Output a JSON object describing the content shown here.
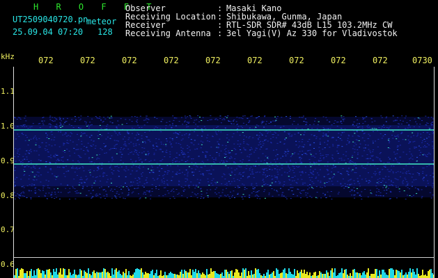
{
  "title_text": "H R O F F T",
  "file_name": "UT2509040720.pn",
  "file_suffix": "meteor",
  "datetime": "25.09.04 07:20",
  "count": "128",
  "fields": [
    {
      "label": "Observer",
      "sep": ":",
      "value": "Masaki Kano"
    },
    {
      "label": "Receiving Location",
      "sep": ":",
      "value": "Shibukawa, Gunma, Japan"
    },
    {
      "label": "Receiver",
      "sep": ":",
      "value": "RTL-SDR SDR# 43dB L15 103.2MHz CW"
    },
    {
      "label": "Receiving Antenna",
      "sep": ":",
      "value": "3el Yagi(V) Az 330 for Vladivostok"
    }
  ],
  "y_unit": "kHz",
  "y_ticks": [
    "1.1",
    "1.0",
    "0.9",
    "0.8",
    "0.7",
    "0.6"
  ],
  "x_ticks": [
    "072",
    "072",
    "072",
    "072",
    "072",
    "072",
    "072",
    "072",
    "072",
    "0730"
  ],
  "colors": {
    "text": "#f2f2f2",
    "title": "#2de82d",
    "file": "#29e6e6",
    "ticks": "#f0f060",
    "signal": "#1a2aa8",
    "echo_line": "#3fe0c0"
  }
}
